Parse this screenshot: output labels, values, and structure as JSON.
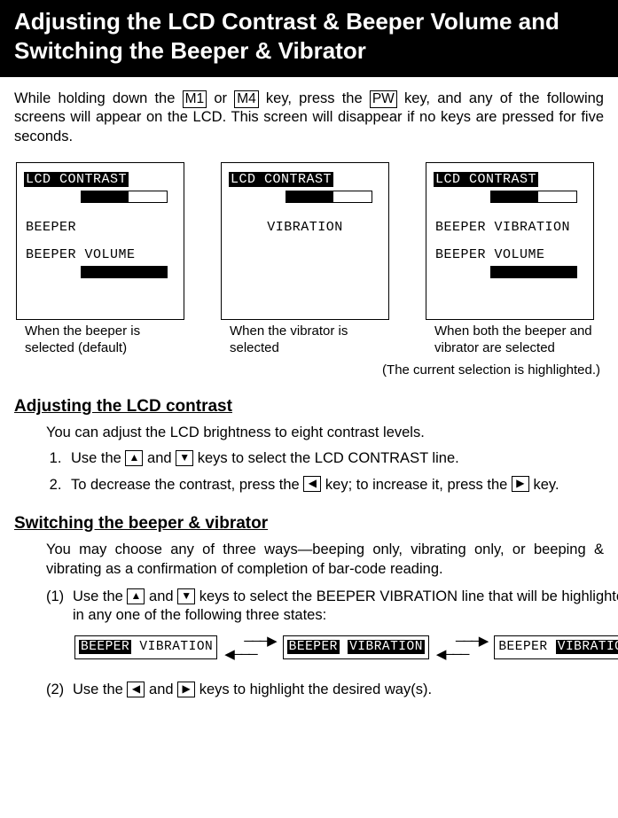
{
  "title": "Adjusting the LCD Contrast & Beeper Volume and Switching the Beeper & Vibrator",
  "intro": {
    "p1a": "While holding down the ",
    "k1": "M1",
    "p1b": " or ",
    "k2": "M4",
    "p1c": " key, press the ",
    "k3": "PW",
    "p1d": " key, and any of the following screens will appear on the LCD.  This screen will disappear if no keys are pressed for five seconds."
  },
  "screens": {
    "lcd": "LCD CONTRAST",
    "s1": {
      "r2": "BEEPER",
      "r3": "BEEPER VOLUME",
      "cap": "When the beeper is selected (default)"
    },
    "s2": {
      "r2": "VIBRATION",
      "cap": "When the vibrator is selected"
    },
    "s3": {
      "r2": "BEEPER VIBRATION",
      "r3": "BEEPER VOLUME",
      "cap": "When both the beeper and vibrator are selected"
    },
    "note": "(The current selection is highlighted.)"
  },
  "sec1": {
    "h": "Adjusting the LCD contrast",
    "p": "You can adjust the LCD brightness to eight contrast levels.",
    "li1a": "Use the ",
    "li1b": " and ",
    "li1c": " keys to select the LCD CONTRAST line.",
    "li2a": "To decrease the contrast, press the ",
    "li2b": " key; to increase it, press the ",
    "li2c": " key."
  },
  "sec2": {
    "h": "Switching the beeper & vibrator",
    "p": "You may choose any of three ways—beeping only, vibrating only, or beeping & vibrating as a confirmation of completion of bar-code reading.",
    "li1a": "Use the ",
    "li1b": " and ",
    "li1c": " keys to select the BEEPER VIBRATION line that will be highlighted in any one of the following three states:",
    "li2a": "Use the ",
    "li2b": " and ",
    "li2c": " keys to highlight the desired way(s)."
  },
  "states": {
    "beeper": "BEEPER",
    "vibration": "VIBRATION"
  },
  "arrows": {
    "up": "▲",
    "down": "▼",
    "left": "◀",
    "right": "▶"
  },
  "step_labels": {
    "s1": "(1)",
    "s2": "(2)"
  }
}
